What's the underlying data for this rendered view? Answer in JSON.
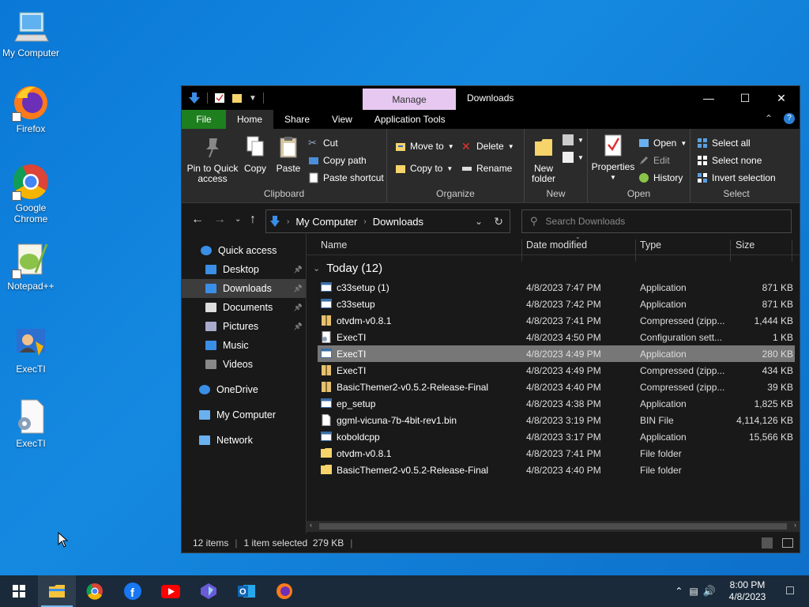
{
  "desktop": {
    "icons": [
      {
        "label": "My Computer"
      },
      {
        "label": "Firefox"
      },
      {
        "label": "Google Chrome"
      },
      {
        "label": "Notepad++"
      },
      {
        "label": "ExecTI"
      },
      {
        "label": "ExecTI"
      }
    ]
  },
  "window": {
    "manage_tab": "Manage",
    "title": "Downloads",
    "tabs": [
      "File",
      "Home",
      "Share",
      "View",
      "Application Tools"
    ],
    "ribbon": {
      "clipboard": {
        "label": "Clipboard",
        "pin": "Pin to Quick access",
        "copy": "Copy",
        "paste": "Paste",
        "cut": "Cut",
        "copy_path": "Copy path",
        "paste_shortcut": "Paste shortcut"
      },
      "organize": {
        "label": "Organize",
        "move_to": "Move to",
        "copy_to": "Copy to",
        "delete": "Delete",
        "rename": "Rename"
      },
      "new": {
        "label": "New",
        "new_folder": "New folder"
      },
      "open": {
        "label": "Open",
        "properties": "Properties",
        "open": "Open",
        "edit": "Edit",
        "history": "History"
      },
      "select": {
        "label": "Select",
        "select_all": "Select all",
        "select_none": "Select none",
        "invert": "Invert selection"
      }
    },
    "address": {
      "root": "My Computer",
      "current": "Downloads",
      "search_placeholder": "Search Downloads"
    },
    "nav": [
      {
        "label": "Quick access",
        "icon": "star-icon"
      },
      {
        "label": "Desktop",
        "icon": "desktop-icon"
      },
      {
        "label": "Downloads",
        "icon": "download-icon"
      },
      {
        "label": "Documents",
        "icon": "documents-icon"
      },
      {
        "label": "Pictures",
        "icon": "pictures-icon"
      },
      {
        "label": "Music",
        "icon": "music-icon"
      },
      {
        "label": "Videos",
        "icon": "videos-icon"
      },
      {
        "label": "OneDrive",
        "icon": "cloud-icon"
      },
      {
        "label": "My Computer",
        "icon": "computer-icon"
      },
      {
        "label": "Network",
        "icon": "network-icon"
      }
    ],
    "columns": {
      "name": "Name",
      "date": "Date modified",
      "type": "Type",
      "size": "Size"
    },
    "group": "Today (12)",
    "files": [
      {
        "name": "c33setup (1)",
        "date": "4/8/2023 7:47 PM",
        "type": "Application",
        "size": "871 KB",
        "icon": "app"
      },
      {
        "name": "c33setup",
        "date": "4/8/2023 7:42 PM",
        "type": "Application",
        "size": "871 KB",
        "icon": "app"
      },
      {
        "name": "otvdm-v0.8.1",
        "date": "4/8/2023 7:41 PM",
        "type": "Compressed (zipp...",
        "size": "1,444 KB",
        "icon": "zip"
      },
      {
        "name": "ExecTI",
        "date": "4/8/2023 4:50 PM",
        "type": "Configuration sett...",
        "size": "1 KB",
        "icon": "cfg"
      },
      {
        "name": "ExecTI",
        "date": "4/8/2023 4:49 PM",
        "type": "Application",
        "size": "280 KB",
        "icon": "app"
      },
      {
        "name": "ExecTI",
        "date": "4/8/2023 4:49 PM",
        "type": "Compressed (zipp...",
        "size": "434 KB",
        "icon": "zip"
      },
      {
        "name": "BasicThemer2-v0.5.2-Release-Final",
        "date": "4/8/2023 4:40 PM",
        "type": "Compressed (zipp...",
        "size": "39 KB",
        "icon": "zip"
      },
      {
        "name": "ep_setup",
        "date": "4/8/2023 4:38 PM",
        "type": "Application",
        "size": "1,825 KB",
        "icon": "app"
      },
      {
        "name": "ggml-vicuna-7b-4bit-rev1.bin",
        "date": "4/8/2023 3:19 PM",
        "type": "BIN File",
        "size": "4,114,126 KB",
        "icon": "file"
      },
      {
        "name": "koboldcpp",
        "date": "4/8/2023 3:17 PM",
        "type": "Application",
        "size": "15,566 KB",
        "icon": "app"
      },
      {
        "name": "otvdm-v0.8.1",
        "date": "4/8/2023 7:41 PM",
        "type": "File folder",
        "size": "",
        "icon": "folder"
      },
      {
        "name": "BasicThemer2-v0.5.2-Release-Final",
        "date": "4/8/2023 4:40 PM",
        "type": "File folder",
        "size": "",
        "icon": "folder"
      }
    ],
    "selected_index": 4,
    "status": {
      "count": "12 items",
      "selection": "1 item selected  279 KB"
    }
  },
  "taskbar": {
    "time": "8:00 PM",
    "date": "4/8/2023"
  }
}
